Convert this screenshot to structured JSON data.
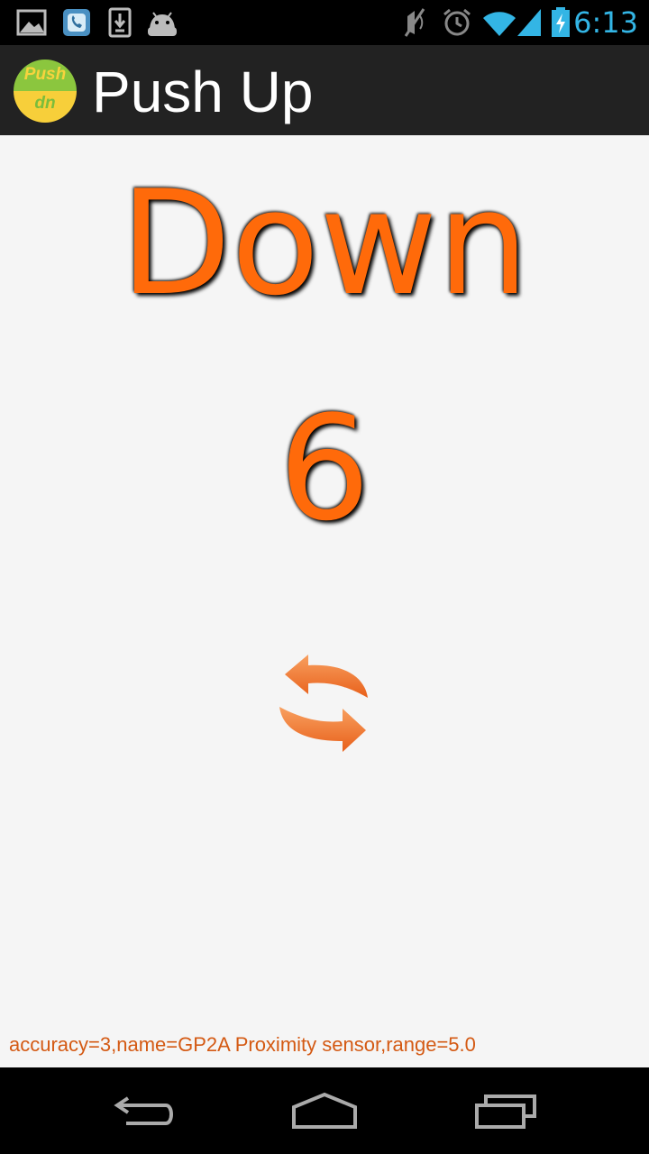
{
  "status_bar": {
    "time": "6:13",
    "icons": [
      "gallery-icon",
      "phone-app-icon",
      "download-icon",
      "android-icon",
      "mute-icon",
      "alarm-icon",
      "wifi-icon",
      "signal-icon",
      "battery-charging-icon"
    ]
  },
  "action_bar": {
    "logo_line1": "Push",
    "logo_line2": "dn",
    "title": "Push Up"
  },
  "main": {
    "state": "Down",
    "count": "6",
    "reset_icon": "refresh-icon",
    "sensor_info": "accuracy=3,name=GP2A Proximity sensor,range=5.0"
  },
  "nav_bar": {
    "buttons": [
      "back-icon",
      "home-icon",
      "recent-apps-icon"
    ]
  },
  "colors": {
    "accent": "#ff6a0a",
    "status_time": "#33b5e5",
    "action_bar_bg": "#222222",
    "content_bg": "#f5f5f5"
  }
}
